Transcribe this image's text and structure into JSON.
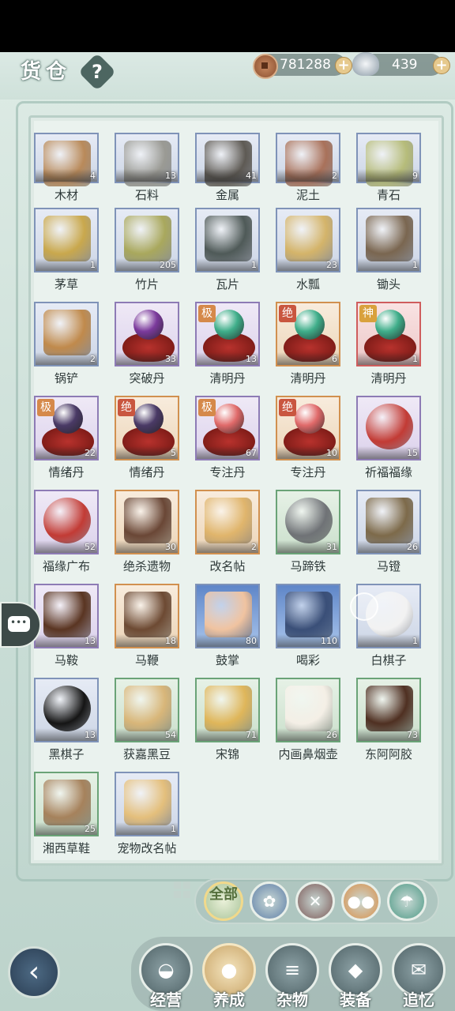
{
  "header": {
    "title": "货仓",
    "help_label": "?",
    "copper_coins": "781288",
    "silver_ingots": "439",
    "add_label": "+"
  },
  "items": [
    {
      "name": "木材",
      "count": "4",
      "quality": "blue",
      "icon": "wood-planks-icon"
    },
    {
      "name": "石料",
      "count": "13",
      "quality": "blue",
      "icon": "stone-blocks-icon"
    },
    {
      "name": "金属",
      "count": "41",
      "quality": "blue",
      "icon": "metal-ingots-icon"
    },
    {
      "name": "泥土",
      "count": "2",
      "quality": "blue",
      "icon": "soil-pile-icon"
    },
    {
      "name": "青石",
      "count": "9",
      "quality": "blue",
      "icon": "green-rock-icon"
    },
    {
      "name": "茅草",
      "count": "1",
      "quality": "blue",
      "icon": "thatch-icon"
    },
    {
      "name": "竹片",
      "count": "205",
      "quality": "blue",
      "icon": "bamboo-mat-icon"
    },
    {
      "name": "瓦片",
      "count": "1",
      "quality": "blue",
      "icon": "roof-tiles-icon"
    },
    {
      "name": "水瓢",
      "count": "23",
      "quality": "blue",
      "icon": "water-gourd-icon"
    },
    {
      "name": "锄头",
      "count": "1",
      "quality": "blue",
      "icon": "hoe-icon"
    },
    {
      "name": "锅铲",
      "count": "2",
      "quality": "blue",
      "icon": "spatula-icon"
    },
    {
      "name": "突破丹",
      "count": "33",
      "quality": "purple",
      "icon": "purple-pill-icon",
      "orb": "#7b3a9c"
    },
    {
      "name": "清明丹",
      "count": "13",
      "quality": "purple",
      "badge": "极",
      "icon": "jade-pill-icon",
      "orb": "#3fae8a"
    },
    {
      "name": "清明丹",
      "count": "6",
      "quality": "orange",
      "badge": "绝",
      "icon": "jade-pill-icon",
      "orb": "#3fae8a"
    },
    {
      "name": "清明丹",
      "count": "1",
      "quality": "red",
      "badge": "神",
      "icon": "jade-pill-icon",
      "orb": "#3fae8a"
    },
    {
      "name": "情绪丹",
      "count": "22",
      "quality": "purple",
      "badge": "极",
      "icon": "dark-pill-icon",
      "orb": "#4a3a66"
    },
    {
      "name": "情绪丹",
      "count": "5",
      "quality": "orange",
      "badge": "绝",
      "icon": "dark-pill-icon",
      "orb": "#4a3a66"
    },
    {
      "name": "专注丹",
      "count": "67",
      "quality": "purple",
      "badge": "极",
      "icon": "pink-pill-icon",
      "orb": "#e06a6a"
    },
    {
      "name": "专注丹",
      "count": "10",
      "quality": "orange",
      "badge": "绝",
      "icon": "pink-pill-icon",
      "orb": "#e06a6a"
    },
    {
      "name": "祈福福缘",
      "count": "15",
      "quality": "purple",
      "icon": "lucky-pouch-icon"
    },
    {
      "name": "福缘广布",
      "count": "52",
      "quality": "purple",
      "icon": "lucky-pouch-icon"
    },
    {
      "name": "绝杀遗物",
      "count": "30",
      "quality": "orange",
      "icon": "wooden-cabinet-icon"
    },
    {
      "name": "改名帖",
      "count": "2",
      "quality": "orange",
      "icon": "rename-card-icon"
    },
    {
      "name": "马蹄铁",
      "count": "31",
      "quality": "green",
      "icon": "horseshoe-icon"
    },
    {
      "name": "马镫",
      "count": "26",
      "quality": "blue",
      "icon": "stirrup-icon"
    },
    {
      "name": "马鞍",
      "count": "13",
      "quality": "purple",
      "icon": "saddle-icon"
    },
    {
      "name": "马鞭",
      "count": "18",
      "quality": "orange",
      "icon": "whip-icon"
    },
    {
      "name": "鼓掌",
      "count": "80",
      "quality": "blue",
      "icon": "clapping-hands-icon"
    },
    {
      "name": "喝彩",
      "count": "110",
      "quality": "blue",
      "icon": "cheering-man-icon"
    },
    {
      "name": "白棋子",
      "count": "1",
      "quality": "blue",
      "icon": "white-go-stone-icon"
    },
    {
      "name": "黑棋子",
      "count": "13",
      "quality": "blue",
      "icon": "black-go-stone-icon"
    },
    {
      "name": "获嘉黑豆",
      "count": "54",
      "quality": "green",
      "icon": "black-bean-jar-icon"
    },
    {
      "name": "宋锦",
      "count": "71",
      "quality": "green",
      "icon": "brocade-scroll-icon"
    },
    {
      "name": "内画鼻烟壶",
      "count": "26",
      "quality": "green",
      "icon": "snuff-bottle-icon"
    },
    {
      "name": "东阿阿胶",
      "count": "73",
      "quality": "green",
      "icon": "donkey-gelatin-icon"
    },
    {
      "name": "湘西草鞋",
      "count": "25",
      "quality": "green",
      "icon": "straw-sandals-icon"
    },
    {
      "name": "宠物改名帖",
      "count": "1",
      "quality": "blue",
      "icon": "pet-rename-card-icon"
    }
  ],
  "filters": [
    {
      "label": "全部",
      "icon": "all-filter-icon",
      "active": true
    },
    {
      "label": "",
      "icon": "pouch-filter-icon"
    },
    {
      "label": "",
      "icon": "tools-filter-icon"
    },
    {
      "label": "",
      "icon": "food-filter-icon"
    },
    {
      "label": "",
      "icon": "umbrella-filter-icon"
    }
  ],
  "nav": [
    {
      "label": "经营",
      "icon": "bowl-icon"
    },
    {
      "label": "养成",
      "icon": "pill-orb-icon",
      "active": true
    },
    {
      "label": "杂物",
      "icon": "sticks-icon"
    },
    {
      "label": "装备",
      "icon": "armor-icon"
    },
    {
      "label": "追忆",
      "icon": "letter-icon"
    }
  ],
  "colors": {
    "accent": "#d9a13d",
    "panel": "#eaf2ee",
    "blue_frame": "#7f93b8",
    "green_frame": "#6aa377",
    "purple_frame": "#8d7bb5",
    "orange_frame": "#d1904f",
    "red_frame": "#cf5d5d"
  }
}
